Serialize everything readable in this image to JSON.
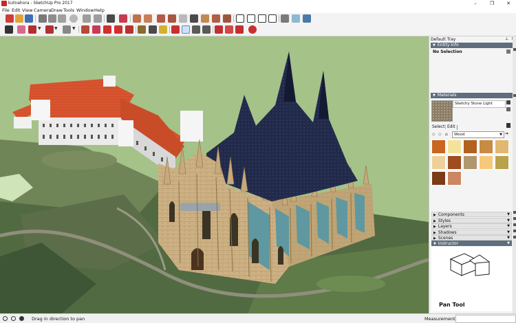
{
  "window": {
    "title": "kutnahora - SketchUp Pro 2017",
    "controls": [
      "–",
      "❐",
      "✕"
    ]
  },
  "menu": [
    "File",
    "Edit",
    "View",
    "Camera",
    "Draw",
    "Tools",
    "Window",
    "Help"
  ],
  "toolbar_icons": {
    "row1": [
      "new-icon",
      "open-icon",
      "save-icon",
      "cut-icon",
      "copy-icon",
      "paste-icon",
      "erase-icon",
      "undo-icon",
      "redo-icon",
      "print-icon",
      "model-info-icon",
      "iso-view-icon",
      "top-view-icon",
      "front-view-icon",
      "right-view-icon",
      "back-view-icon",
      "left-view-icon",
      "xray-icon",
      "back-edges-icon",
      "wireframe-icon",
      "hidden-line-icon",
      "shaded-icon",
      "shaded-textures-icon",
      "monochrome-icon",
      "house-icon",
      "house-outline-icon",
      "house-left-icon",
      "house-right-icon",
      "box-icon",
      "layer-icon",
      "3d-warehouse-icon"
    ],
    "row2": [
      "select-icon",
      "eraser-icon",
      "pencil-icon",
      "line-dropdown-icon",
      "arc-icon",
      "arc-dropdown-icon",
      "rectangle-icon",
      "rectangle-dropdown-icon",
      "push-pull-icon",
      "follow-me-icon",
      "move-icon",
      "rotate-icon",
      "scale-icon",
      "offset-icon",
      "tape-measure-icon",
      "dimension-icon",
      "protractor-icon",
      "text-icon",
      "axes-icon",
      "3d-text-icon",
      "orbit-icon",
      "pan-icon",
      "zoom-icon",
      "zoom-extents-icon",
      "warehouse-icon",
      "extension-warehouse-icon",
      "components-icon",
      "layout-icon"
    ]
  },
  "tray": {
    "title": "Default Tray",
    "entity_info": {
      "header": "Entity Info",
      "selection": "No Selection"
    },
    "materials": {
      "header": "Materials",
      "current_name": "Sketchy Stone Light",
      "tabs": [
        "Select",
        "Edit"
      ],
      "category": "Wood",
      "swatches": [
        "#c8651f",
        "#f3e29a",
        "#b2621e",
        "#c98a44",
        "#e1b86f",
        "#efd09a",
        "#9e4c20",
        "#b0976d",
        "#f6c879",
        "#b8a24a",
        "#7b3b17",
        "#cc8662"
      ]
    },
    "panels": [
      "Components",
      "Styles",
      "Layers",
      "Shadows",
      "Scenes",
      "Instructor"
    ],
    "instructor": {
      "tool_name": "Pan Tool"
    }
  },
  "status": {
    "message": "Drag in direction to pan",
    "measurements_label": "Measurements",
    "measurements_value": ""
  },
  "colors": {
    "sky_green": "#a3c187",
    "roof_red": "#d9502d",
    "roof_dark": "#1e2540",
    "stone": "#c8ae82",
    "glass": "#5f98a0"
  }
}
